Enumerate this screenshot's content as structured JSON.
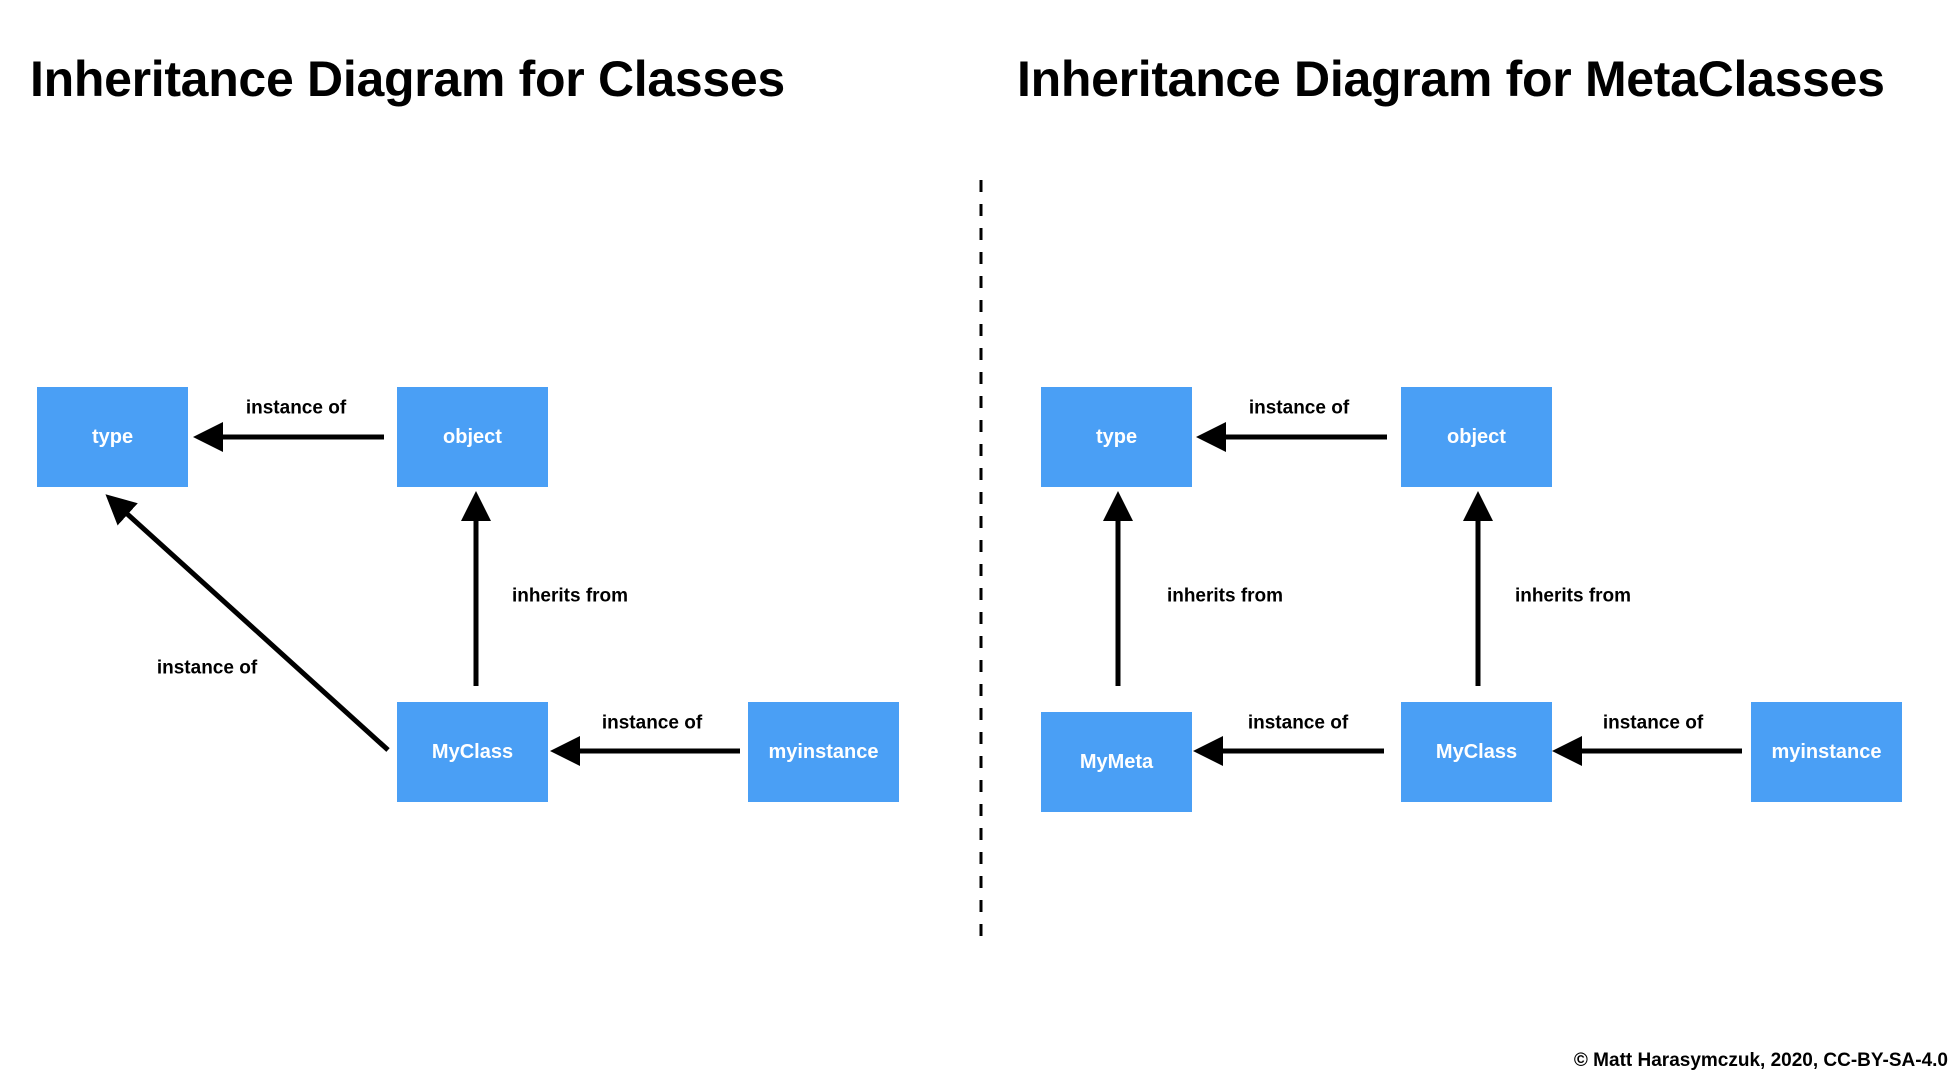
{
  "titles": {
    "left": "Inheritance Diagram for Classes",
    "right": "Inheritance Diagram for MetaClasses"
  },
  "colors": {
    "node_fill": "#4A9FF5",
    "node_text": "#ffffff",
    "edge": "#000000"
  },
  "diagrams": [
    {
      "id": "classes",
      "nodes": [
        {
          "id": "type",
          "label": "type"
        },
        {
          "id": "object",
          "label": "object"
        },
        {
          "id": "MyClass",
          "label": "MyClass"
        },
        {
          "id": "myinstance",
          "label": "myinstance"
        }
      ],
      "edges": [
        {
          "from": "object",
          "to": "type",
          "label": "instance of"
        },
        {
          "from": "MyClass",
          "to": "object",
          "label": "inherits from"
        },
        {
          "from": "MyClass",
          "to": "type",
          "label": "instance of"
        },
        {
          "from": "myinstance",
          "to": "MyClass",
          "label": "instance of"
        }
      ]
    },
    {
      "id": "metaclasses",
      "nodes": [
        {
          "id": "type",
          "label": "type"
        },
        {
          "id": "object",
          "label": "object"
        },
        {
          "id": "MyMeta",
          "label": "MyMeta"
        },
        {
          "id": "MyClass",
          "label": "MyClass"
        },
        {
          "id": "myinstance",
          "label": "myinstance"
        }
      ],
      "edges": [
        {
          "from": "object",
          "to": "type",
          "label": "instance of"
        },
        {
          "from": "MyMeta",
          "to": "type",
          "label": "inherits from"
        },
        {
          "from": "MyClass",
          "to": "object",
          "label": "inherits from"
        },
        {
          "from": "MyClass",
          "to": "MyMeta",
          "label": "instance of"
        },
        {
          "from": "myinstance",
          "to": "MyClass",
          "label": "instance of"
        }
      ]
    }
  ],
  "copyright": "© Matt Harasymczuk, 2020, CC-BY-SA-4.0"
}
